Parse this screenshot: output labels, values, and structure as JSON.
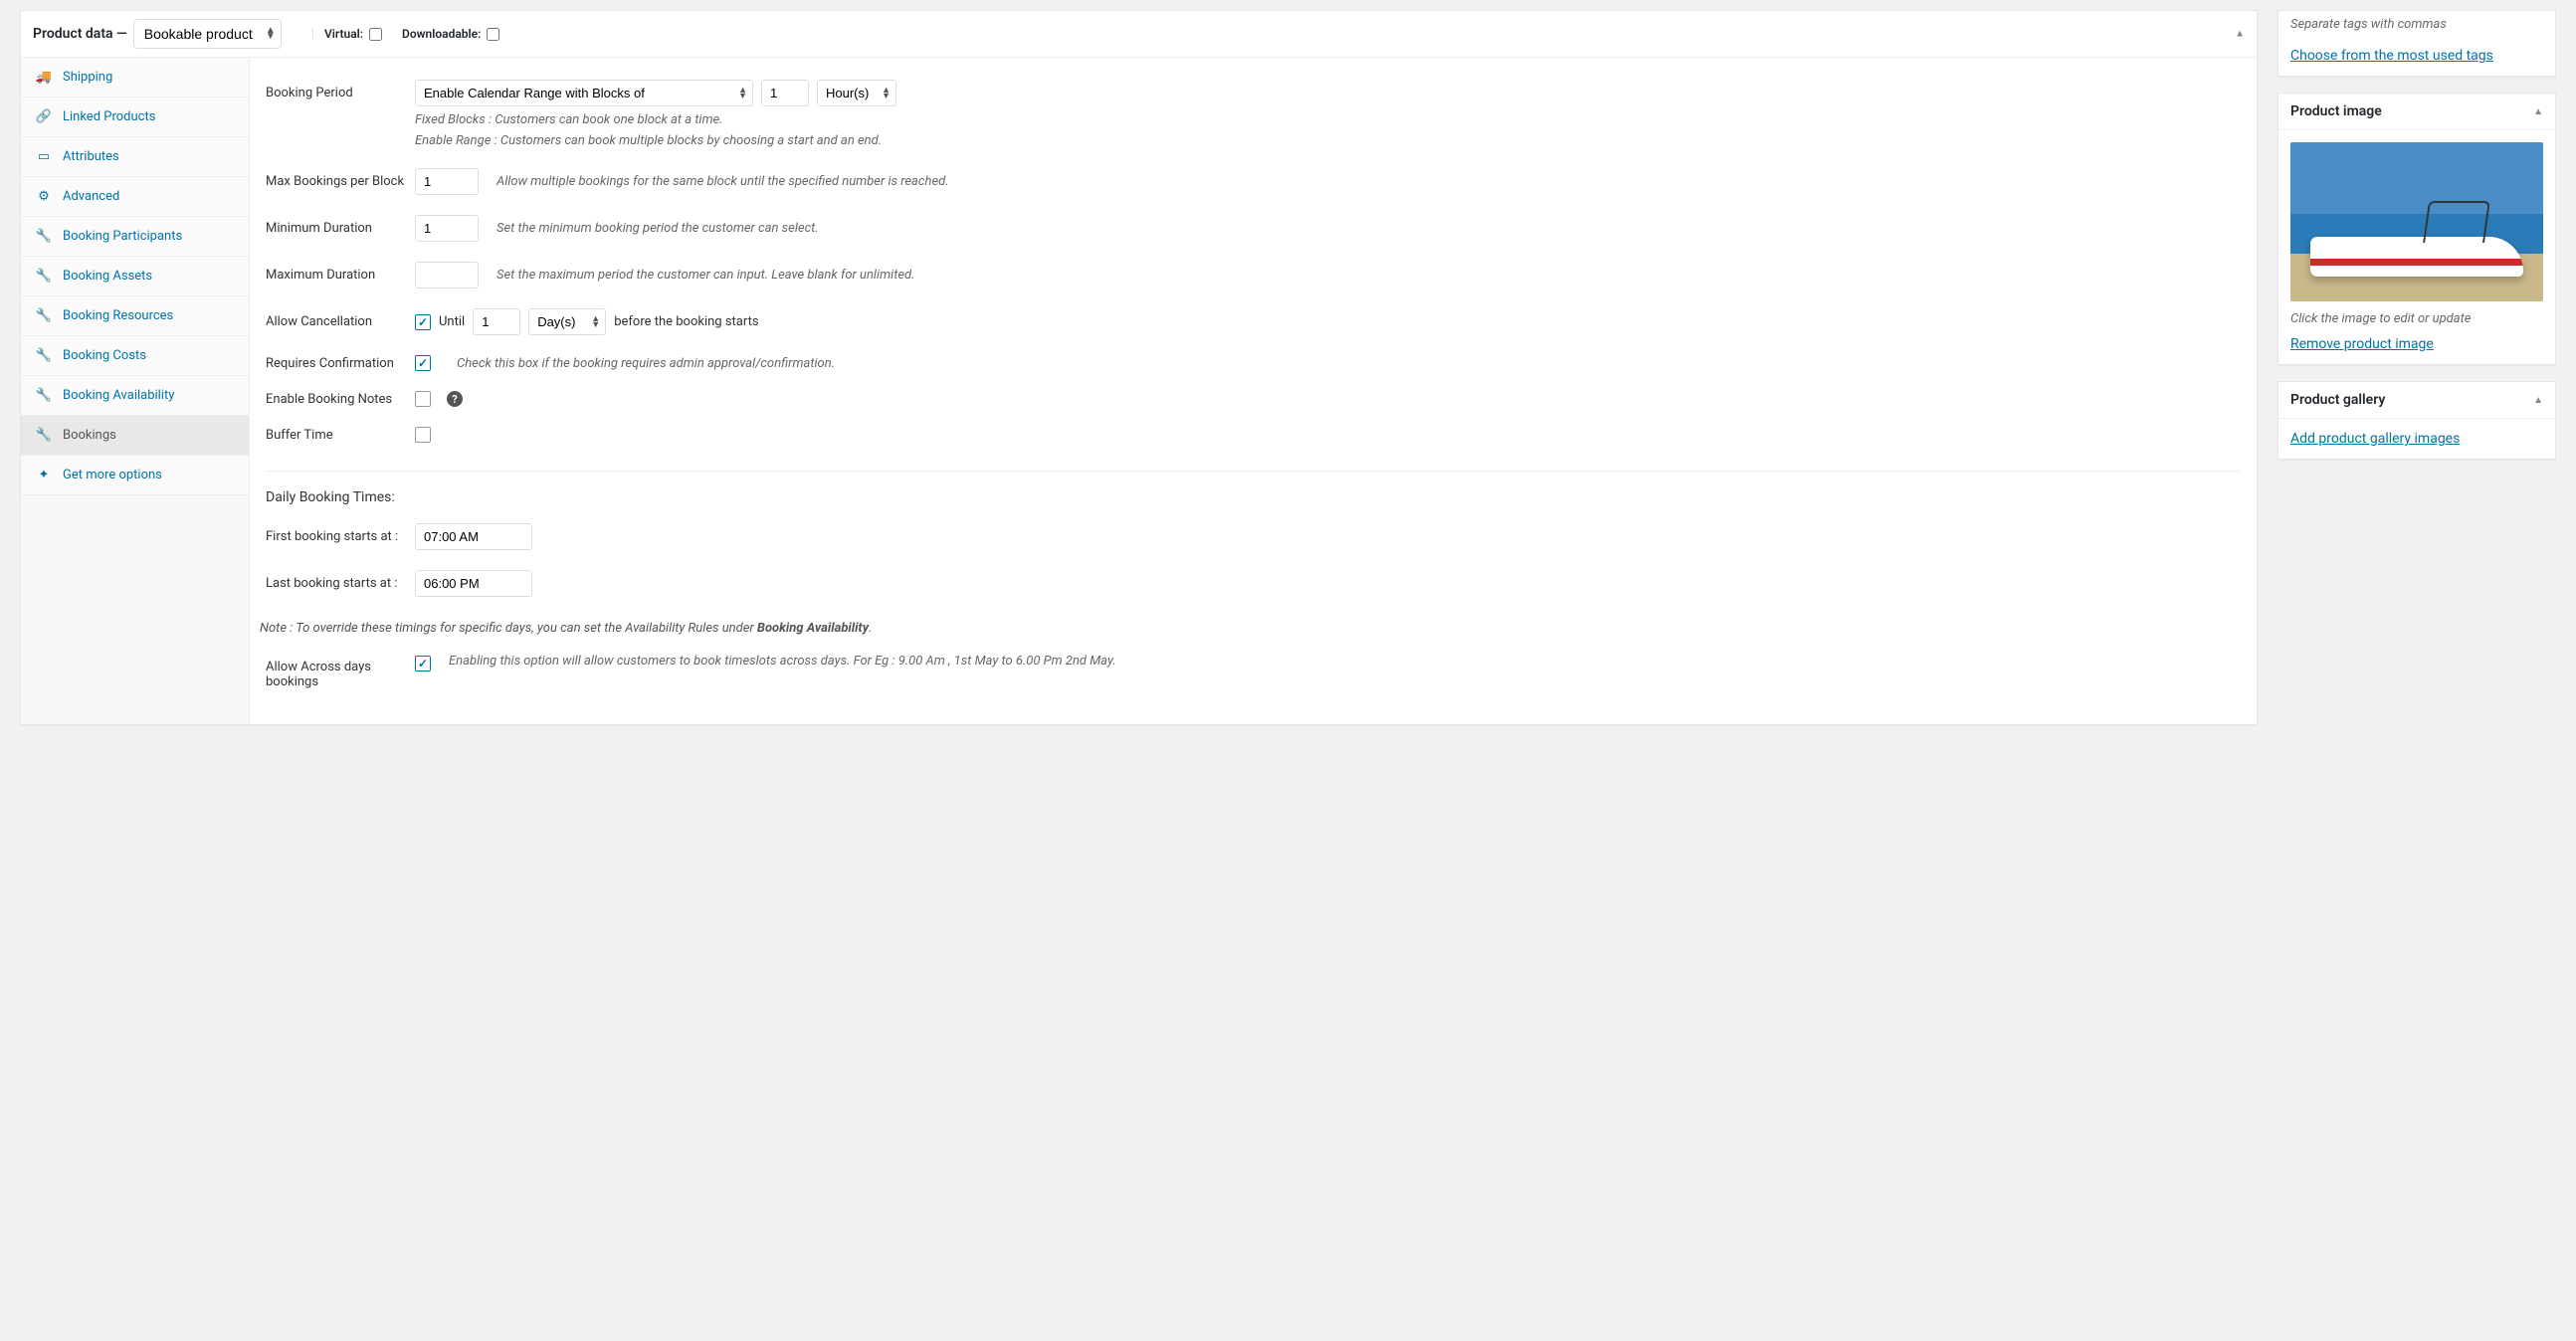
{
  "product_data": {
    "title": "Product data —",
    "product_type": "Bookable product",
    "virtual_label": "Virtual:",
    "downloadable_label": "Downloadable:",
    "virtual_checked": false,
    "downloadable_checked": false
  },
  "tabs": [
    {
      "label": "Shipping",
      "icon": "truck"
    },
    {
      "label": "Linked Products",
      "icon": "link"
    },
    {
      "label": "Attributes",
      "icon": "list"
    },
    {
      "label": "Advanced",
      "icon": "gear"
    },
    {
      "label": "Booking Participants",
      "icon": "wrench"
    },
    {
      "label": "Booking Assets",
      "icon": "wrench"
    },
    {
      "label": "Booking Resources",
      "icon": "wrench"
    },
    {
      "label": "Booking Costs",
      "icon": "wrench"
    },
    {
      "label": "Booking Availability",
      "icon": "wrench"
    },
    {
      "label": "Bookings",
      "icon": "wrench",
      "active": true
    },
    {
      "label": "Get more options",
      "icon": "sparkle"
    }
  ],
  "form": {
    "booking_period": {
      "label": "Booking Period",
      "select": "Enable Calendar Range with Blocks of",
      "qty": "1",
      "unit": "Hour(s)",
      "help1": "Fixed Blocks : Customers can book one block at a time.",
      "help2": "Enable Range : Customers can book multiple blocks by choosing a start and an end."
    },
    "max_bookings": {
      "label": "Max Bookings per Block",
      "value": "1",
      "help": "Allow multiple bookings for the same block until the specified number is reached."
    },
    "min_duration": {
      "label": "Minimum Duration",
      "value": "1",
      "help": "Set the minimum booking period the customer can select."
    },
    "max_duration": {
      "label": "Maximum Duration",
      "value": "",
      "help": "Set the maximum period the customer can input. Leave blank for unlimited."
    },
    "allow_cancellation": {
      "label": "Allow Cancellation",
      "checked": true,
      "until_label": "Until",
      "value": "1",
      "unit": "Day(s)",
      "help": "before the booking starts"
    },
    "requires_confirmation": {
      "label": "Requires Confirmation",
      "checked": true,
      "help": "Check this box if the booking requires admin approval/confirmation."
    },
    "enable_notes": {
      "label": "Enable Booking Notes",
      "checked": false
    },
    "buffer_time": {
      "label": "Buffer Time",
      "checked": false
    },
    "daily_booking_times": {
      "title": "Daily Booking Times:",
      "first_label": "First booking starts at :",
      "first_value": "07:00 AM",
      "last_label": "Last booking starts at :",
      "last_value": "06:00 PM",
      "note_prefix": "Note : To override these timings for specific days, you can set the Availability Rules under ",
      "note_bold": "Booking Availability",
      "note_suffix": "."
    },
    "allow_across_days": {
      "label": "Allow Across days bookings",
      "checked": true,
      "help": "Enabling this option will allow customers to book timeslots across days. For Eg : 9.00 Am , 1st May to 6.00 Pm 2nd May."
    }
  },
  "sidebar": {
    "tags_hint": "Separate tags with commas",
    "tags_link": "Choose from the most used tags",
    "product_image": {
      "title": "Product image",
      "hint": "Click the image to edit or update",
      "remove_link": "Remove product image"
    },
    "product_gallery": {
      "title": "Product gallery",
      "add_link": "Add product gallery images"
    }
  }
}
